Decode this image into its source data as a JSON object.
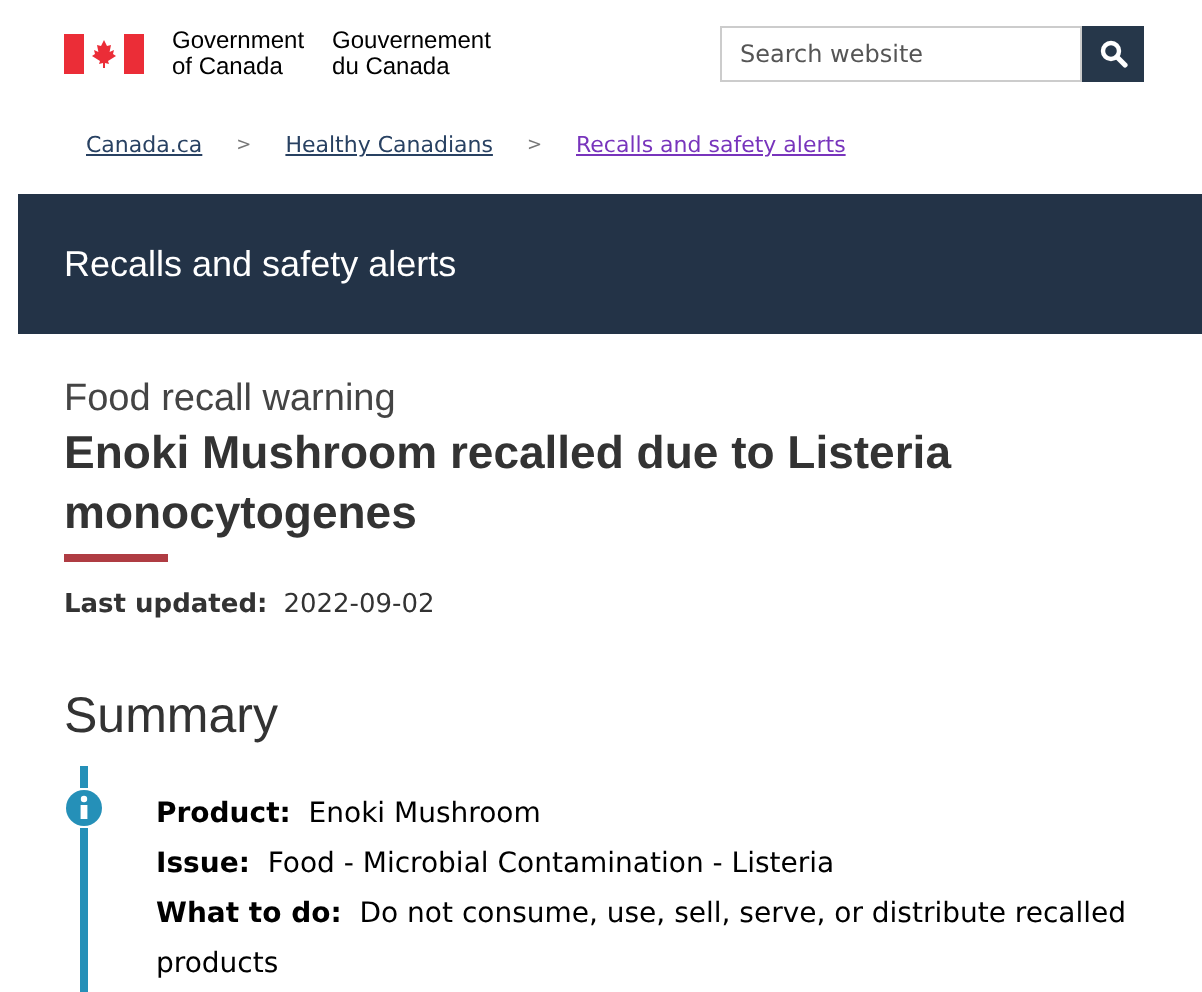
{
  "header": {
    "wordmark_en": [
      "Government",
      "of Canada"
    ],
    "wordmark_fr": [
      "Gouvernement",
      "du Canada"
    ],
    "search": {
      "placeholder": "Search website"
    }
  },
  "breadcrumbs": [
    {
      "label": "Canada.ca",
      "visited": false,
      "separator": ">"
    },
    {
      "label": "Healthy Canadians",
      "visited": false,
      "separator": ">"
    },
    {
      "label": "Recalls and safety alerts",
      "visited": true
    }
  ],
  "banner": {
    "title": "Recalls and safety alerts"
  },
  "page": {
    "kicker": "Food recall warning",
    "title": "Enoki Mushroom recalled due to Listeria monocytogenes",
    "updated_label": "Last updated:",
    "updated_value": "2022-09-02"
  },
  "summary": {
    "heading": "Summary",
    "items": [
      {
        "label": "Product:",
        "value": "Enoki Mushroom"
      },
      {
        "label": "Issue:",
        "value": "Food - Microbial Contamination - Listeria"
      },
      {
        "label": "What to do:",
        "value": "Do not consume, use, sell, serve, or distribute recalled products"
      }
    ]
  }
}
